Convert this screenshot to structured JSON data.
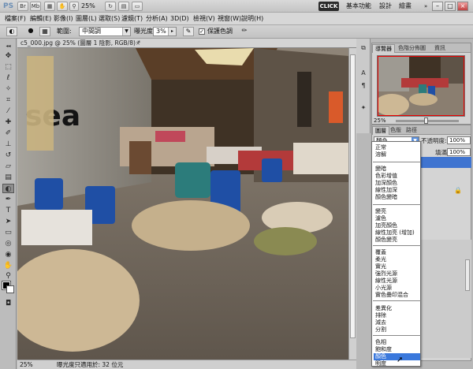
{
  "appbar": {
    "logo": "PS",
    "zoom": "25%",
    "click_badge": "CLICK",
    "workspaces": [
      "基本功能",
      "設計",
      "繪畫"
    ],
    "more": "»",
    "window_buttons": [
      "–",
      "□",
      "×"
    ]
  },
  "menubar": {
    "items": [
      "檔案(F)",
      "編輯(E)",
      "影像(I)",
      "圖層(L)",
      "選取(S)",
      "濾鏡(T)",
      "分析(A)",
      "3D(D)",
      "檢視(V)",
      "視窗(W)",
      "說明(H)"
    ]
  },
  "options": {
    "range_label": "範圍:",
    "range_value": "中間調",
    "exposure_label": "曝光度:",
    "exposure_value": "3%",
    "protect_label": "保護色調",
    "protect_checked": "✓"
  },
  "document": {
    "tab_label": "c5_000.jpg @ 25% (圖層 1 陰影, RGB/8) *",
    "close": "×",
    "photo_sign": "sea",
    "status_zoom": "25%",
    "status_info": "曝光度只適用於: 32 位元"
  },
  "navigator": {
    "tabs": [
      "導覽器",
      "色階分佈圖",
      "資訊"
    ],
    "zoom": "25%"
  },
  "layers": {
    "tabs": [
      "圖層",
      "色版",
      "路徑"
    ],
    "blend_mode": "顏色",
    "opacity_label": "不透明度:",
    "opacity_value": "100%",
    "fill_label": "填滿:",
    "fill_value": "100%"
  },
  "blend_groups": [
    [
      "正常",
      "溶解"
    ],
    [
      "變暗",
      "色彩增值",
      "加深顏色",
      "線性加深",
      "顏色變暗"
    ],
    [
      "變亮",
      "濾色",
      "加亮顏色",
      "線性加亮 (增加)",
      "顏色變亮"
    ],
    [
      "覆蓋",
      "柔光",
      "實光",
      "強烈光源",
      "線性光源",
      "小光源",
      "實色疊印混合"
    ],
    [
      "差異化",
      "排除",
      "減去",
      "分割"
    ],
    [
      "色相",
      "飽和度",
      "顏色",
      "明度"
    ]
  ],
  "colors": {
    "accent": "#3a78dc",
    "click_badge_bg": "#2b2b2b"
  }
}
